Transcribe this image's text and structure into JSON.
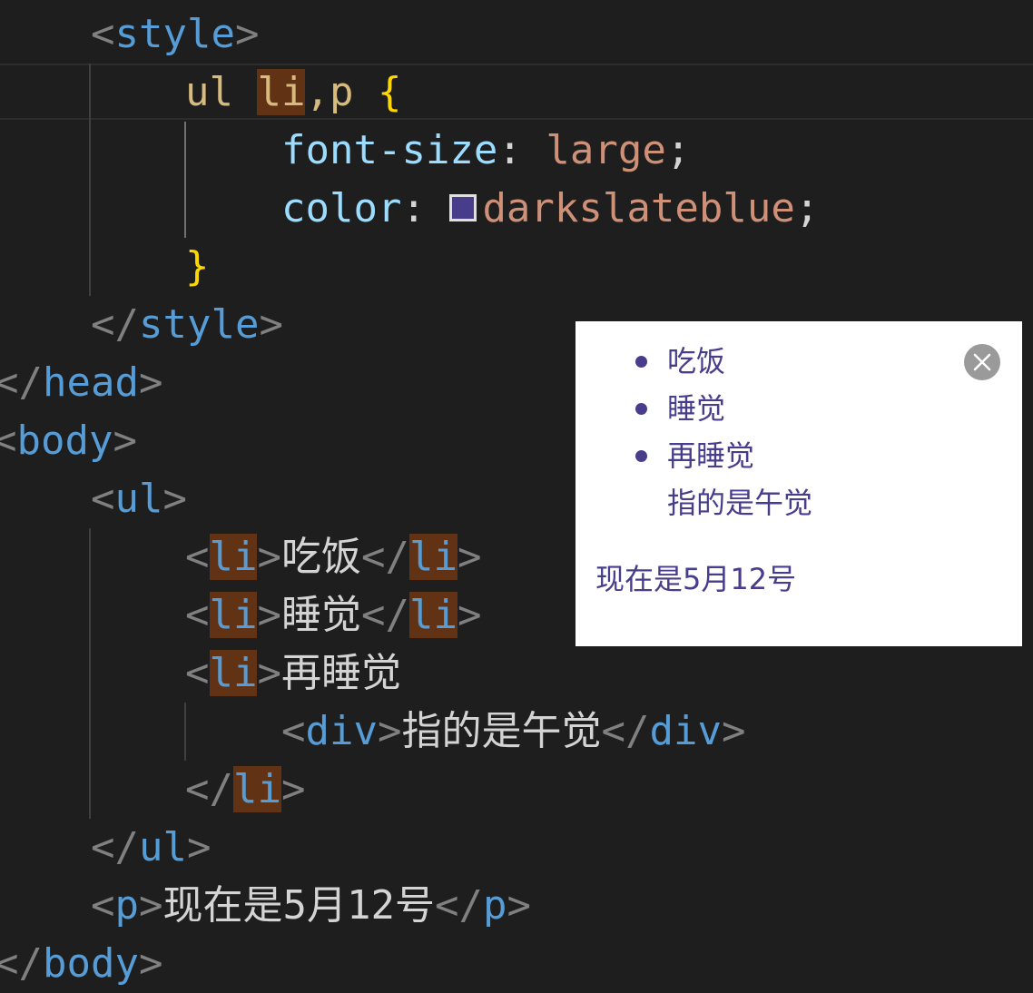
{
  "colors": {
    "swatch": "#483d8b",
    "preview_text": "#483d8b",
    "close_button_bg": "#9a9a9a"
  },
  "code": {
    "style_open": {
      "open": "<",
      "tag": "style",
      "close": ">"
    },
    "rule_selector_ul": "ul ",
    "rule_selector_li": "li",
    "rule_selector_rest": ",p ",
    "rule_brace_open": "{",
    "prop_font_size": "font-size",
    "colon1": ": ",
    "value_large": "large",
    "semi1": ";",
    "prop_color": "color",
    "colon2": ": ",
    "value_color": "darkslateblue",
    "semi2": ";",
    "rule_brace_close": "}",
    "style_close": {
      "open": "</",
      "tag": "style",
      "close": ">"
    },
    "head_close": {
      "open": "</",
      "tag": "head",
      "close": ">"
    },
    "body_open": {
      "open": "<",
      "tag": "body",
      "close": ">"
    },
    "ul_open": {
      "open": "<",
      "tag": "ul",
      "close": ">"
    },
    "li_tag": "li",
    "lt": "<",
    "gt": ">",
    "lt_slash": "</",
    "li1_text": "吃饭",
    "li2_text": "睡觉",
    "li3_text": "再睡觉",
    "div_tag": "div",
    "div_text": "指的是午觉",
    "ul_close": {
      "open": "</",
      "tag": "ul",
      "close": ">"
    },
    "p_tag": "p",
    "p_text": "现在是5月12号",
    "body_close": {
      "open": "</",
      "tag": "body",
      "close": ">"
    }
  },
  "preview": {
    "items": [
      "吃饭",
      "睡觉",
      "再睡觉"
    ],
    "sub_text": "指的是午觉",
    "paragraph": "现在是5月12号",
    "close_icon": "close-icon"
  }
}
